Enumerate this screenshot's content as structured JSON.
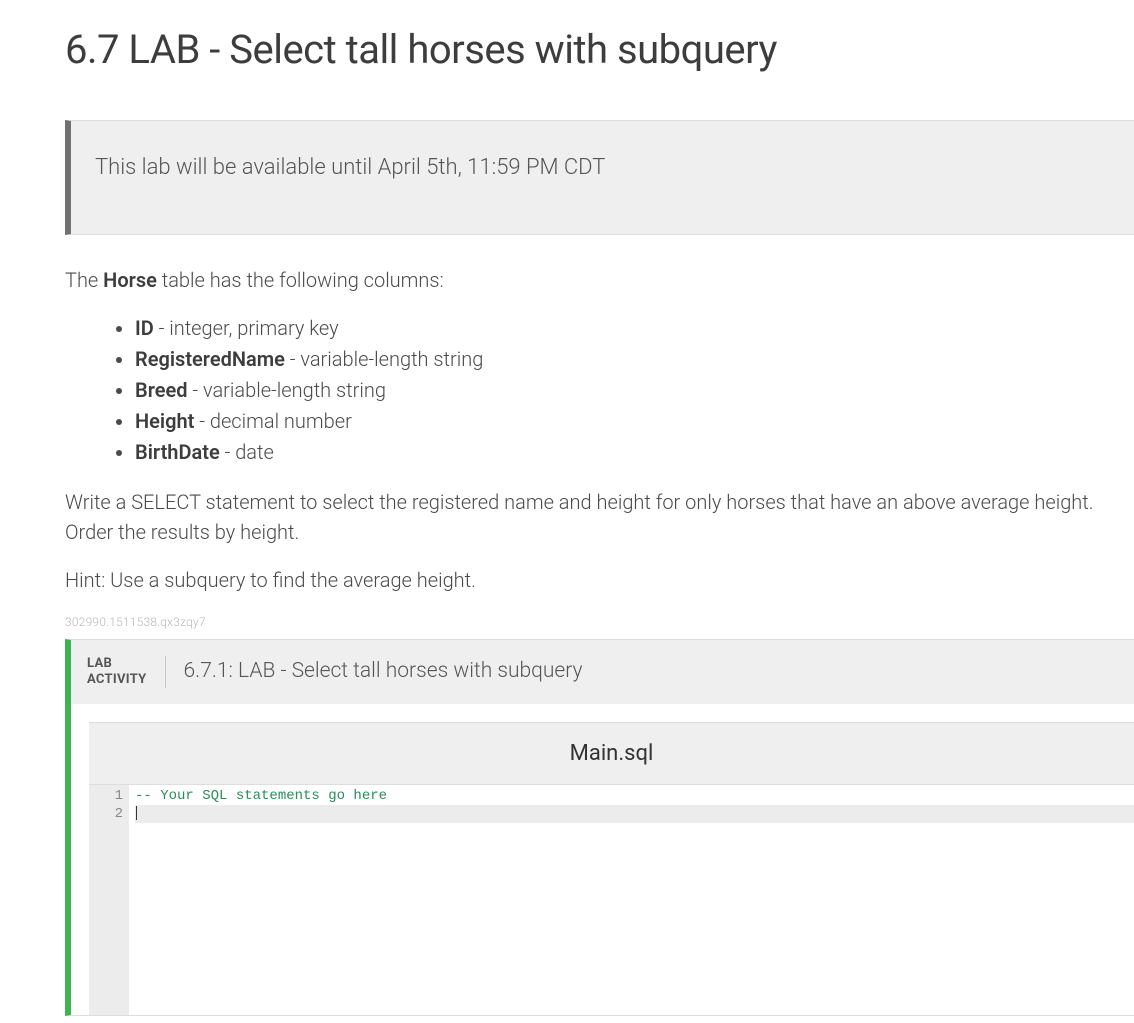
{
  "title": "6.7 LAB - Select tall horses with subquery",
  "notice": "This lab will be available until April 5th, 11:59 PM CDT",
  "intro": {
    "prefix": "The ",
    "table_name": "Horse",
    "suffix": " table has the following columns:"
  },
  "columns": [
    {
      "name": "ID",
      "desc": " - integer, primary key"
    },
    {
      "name": "RegisteredName",
      "desc": " - variable-length string"
    },
    {
      "name": "Breed",
      "desc": " - variable-length string"
    },
    {
      "name": "Height",
      "desc": " - decimal number"
    },
    {
      "name": "BirthDate",
      "desc": " - date"
    }
  ],
  "instruction": "Write a SELECT statement to select the registered name and height for only horses that have an above average height. Order the results by height.",
  "hint": "Hint: Use a subquery to find the average height.",
  "small_id": "302990.1511538.qx3zqy7",
  "lab": {
    "label_line1": "LAB",
    "label_line2": "ACTIVITY",
    "title": "6.7.1: LAB - Select tall horses with subquery",
    "file_name": "Main.sql",
    "editor": {
      "lines": [
        {
          "num": "1",
          "text": "-- Your SQL statements go here",
          "class": "comment",
          "active": false
        },
        {
          "num": "2",
          "text": "",
          "class": "",
          "active": true
        }
      ]
    }
  }
}
